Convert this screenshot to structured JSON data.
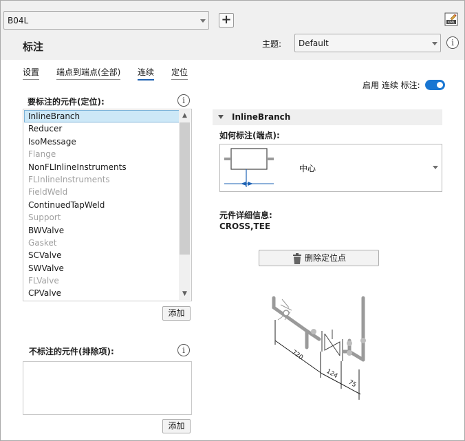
{
  "header": {
    "config_select": "B04L",
    "add_label": "+",
    "title": "标注",
    "theme_label": "主题:",
    "theme_value": "Default"
  },
  "tabs": [
    {
      "label": "设置"
    },
    {
      "label": "端点到端点(全部)"
    },
    {
      "label": "连续"
    },
    {
      "label": "定位"
    }
  ],
  "left": {
    "include_label": "要标注的元件(定位):",
    "items": [
      {
        "label": "InlineBranch",
        "state": "selected"
      },
      {
        "label": "Reducer",
        "state": "enabled"
      },
      {
        "label": "IsoMessage",
        "state": "enabled"
      },
      {
        "label": "Flange",
        "state": "disabled"
      },
      {
        "label": "NonFLInlineInstruments",
        "state": "enabled"
      },
      {
        "label": "FLInlineInstruments",
        "state": "disabled"
      },
      {
        "label": "FieldWeld",
        "state": "disabled"
      },
      {
        "label": "ContinuedTapWeld",
        "state": "enabled"
      },
      {
        "label": "Support",
        "state": "disabled"
      },
      {
        "label": "BWValve",
        "state": "enabled"
      },
      {
        "label": "Gasket",
        "state": "disabled"
      },
      {
        "label": "SCValve",
        "state": "enabled"
      },
      {
        "label": "SWValve",
        "state": "enabled"
      },
      {
        "label": "FLValve",
        "state": "disabled"
      },
      {
        "label": "CPValve",
        "state": "enabled"
      }
    ],
    "add_button": "添加",
    "exclude_label": "不标注的元件(排除项):",
    "add_button_2": "添加"
  },
  "right": {
    "enable_label": "启用 连续 标注:",
    "enable_on": true,
    "group_title": "InlineBranch",
    "how_label": "如何标注(端点):",
    "anno_value": "中心",
    "detail_label": "元件详细信息:",
    "detail_value": "CROSS,TEE",
    "delete_button": "删除定位点"
  },
  "diagram": {
    "dims": [
      "720",
      "124",
      "75"
    ]
  },
  "colors": {
    "accent": "#1976d2",
    "tab_underline": "#1c5fb0",
    "selected_bg": "#cde8f7"
  }
}
